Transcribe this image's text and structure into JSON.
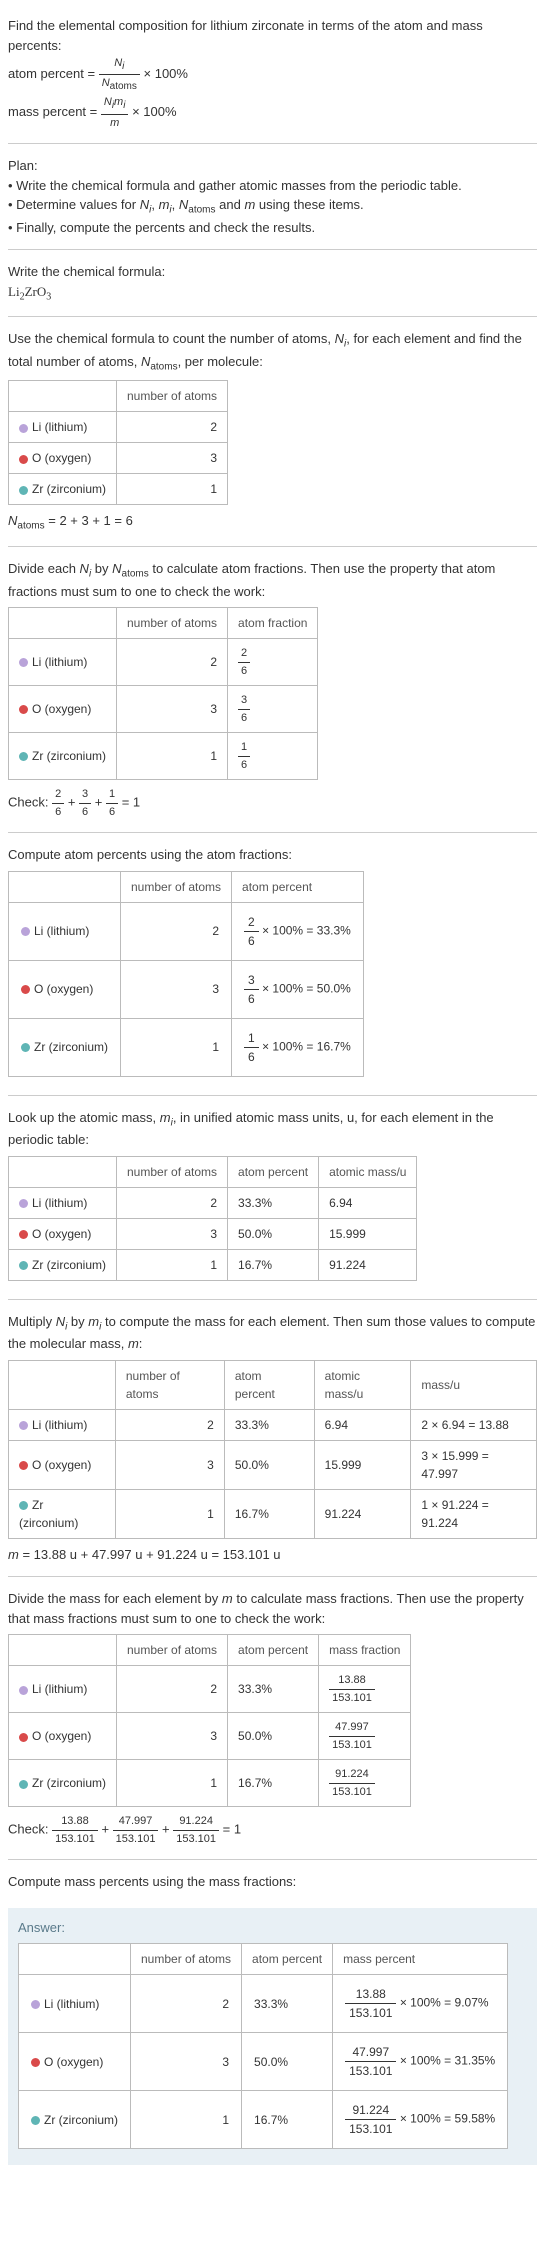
{
  "intro": {
    "line1": "Find the elemental composition for lithium zirconate in terms of the atom and mass percents:",
    "atom_percent_label": "atom percent = ",
    "atom_percent_frac_num": "N_i",
    "atom_percent_frac_den": "N_atoms",
    "times100": " × 100%",
    "mass_percent_label": "mass percent = ",
    "mass_percent_frac_num": "N_i m_i",
    "mass_percent_frac_den": "m"
  },
  "plan": {
    "title": "Plan:",
    "b1": "• Write the chemical formula and gather atomic masses from the periodic table.",
    "b2_a": "• Determine values for ",
    "b2_vars": "N_i, m_i, N_atoms and m",
    "b2_b": " using these items.",
    "b3": "• Finally, compute the percents and check the results."
  },
  "formula_section": {
    "title": "Write the chemical formula:",
    "formula": "Li₂ZrO₃"
  },
  "count_section": {
    "intro_a": "Use the chemical formula to count the number of atoms, ",
    "intro_var1": "N_i",
    "intro_b": ", for each element and find the total number of atoms, ",
    "intro_var2": "N_atoms",
    "intro_c": ", per molecule:",
    "headers": [
      "",
      "number of atoms"
    ],
    "rows": [
      {
        "el": "Li (lithium)",
        "dot": "dot-li",
        "n": "2"
      },
      {
        "el": "O (oxygen)",
        "dot": "dot-o",
        "n": "3"
      },
      {
        "el": "Zr (zirconium)",
        "dot": "dot-zr",
        "n": "1"
      }
    ],
    "sum": "N_atoms = 2 + 3 + 1 = 6"
  },
  "atomfrac_section": {
    "intro": "Divide each N_i by N_atoms to calculate atom fractions. Then use the property that atom fractions must sum to one to check the work:",
    "headers": [
      "",
      "number of atoms",
      "atom fraction"
    ],
    "rows": [
      {
        "el": "Li (lithium)",
        "dot": "dot-li",
        "n": "2",
        "fnum": "2",
        "fden": "6"
      },
      {
        "el": "O (oxygen)",
        "dot": "dot-o",
        "n": "3",
        "fnum": "3",
        "fden": "6"
      },
      {
        "el": "Zr (zirconium)",
        "dot": "dot-zr",
        "n": "1",
        "fnum": "1",
        "fden": "6"
      }
    ],
    "check_label": "Check: ",
    "check_expr": "2/6 + 3/6 + 1/6 = 1"
  },
  "atompercent_section": {
    "intro": "Compute atom percents using the atom fractions:",
    "headers": [
      "",
      "number of atoms",
      "atom percent"
    ],
    "rows": [
      {
        "el": "Li (lithium)",
        "dot": "dot-li",
        "n": "2",
        "fnum": "2",
        "fden": "6",
        "result": " × 100% = 33.3%"
      },
      {
        "el": "O (oxygen)",
        "dot": "dot-o",
        "n": "3",
        "fnum": "3",
        "fden": "6",
        "result": " × 100% = 50.0%"
      },
      {
        "el": "Zr (zirconium)",
        "dot": "dot-zr",
        "n": "1",
        "fnum": "1",
        "fden": "6",
        "result": " × 100% = 16.7%"
      }
    ]
  },
  "atomicmass_section": {
    "intro": "Look up the atomic mass, m_i, in unified atomic mass units, u, for each element in the periodic table:",
    "headers": [
      "",
      "number of atoms",
      "atom percent",
      "atomic mass/u"
    ],
    "rows": [
      {
        "el": "Li (lithium)",
        "dot": "dot-li",
        "n": "2",
        "p": "33.3%",
        "m": "6.94"
      },
      {
        "el": "O (oxygen)",
        "dot": "dot-o",
        "n": "3",
        "p": "50.0%",
        "m": "15.999"
      },
      {
        "el": "Zr (zirconium)",
        "dot": "dot-zr",
        "n": "1",
        "p": "16.7%",
        "m": "91.224"
      }
    ]
  },
  "mass_section": {
    "intro": "Multiply N_i by m_i to compute the mass for each element. Then sum those values to compute the molecular mass, m:",
    "headers": [
      "",
      "number of atoms",
      "atom percent",
      "atomic mass/u",
      "mass/u"
    ],
    "rows": [
      {
        "el": "Li (lithium)",
        "dot": "dot-li",
        "n": "2",
        "p": "33.3%",
        "m": "6.94",
        "calc": "2 × 6.94 = 13.88"
      },
      {
        "el": "O (oxygen)",
        "dot": "dot-o",
        "n": "3",
        "p": "50.0%",
        "m": "15.999",
        "calc": "3 × 15.999 = 47.997"
      },
      {
        "el": "Zr (zirconium)",
        "dot": "dot-zr",
        "n": "1",
        "p": "16.7%",
        "m": "91.224",
        "calc": "1 × 91.224 = 91.224"
      }
    ],
    "total": "m = 13.88 u + 47.997 u + 91.224 u = 153.101 u"
  },
  "massfrac_section": {
    "intro": "Divide the mass for each element by m to calculate mass fractions. Then use the property that mass fractions must sum to one to check the work:",
    "headers": [
      "",
      "number of atoms",
      "atom percent",
      "mass fraction"
    ],
    "rows": [
      {
        "el": "Li (lithium)",
        "dot": "dot-li",
        "n": "2",
        "p": "33.3%",
        "fnum": "13.88",
        "fden": "153.101"
      },
      {
        "el": "O (oxygen)",
        "dot": "dot-o",
        "n": "3",
        "p": "50.0%",
        "fnum": "47.997",
        "fden": "153.101"
      },
      {
        "el": "Zr (zirconium)",
        "dot": "dot-zr",
        "n": "1",
        "p": "16.7%",
        "fnum": "91.224",
        "fden": "153.101"
      }
    ],
    "check_label": "Check: ",
    "check_parts": [
      {
        "num": "13.88",
        "den": "153.101"
      },
      {
        "num": "47.997",
        "den": "153.101"
      },
      {
        "num": "91.224",
        "den": "153.101"
      }
    ],
    "check_eq": " = 1"
  },
  "final_intro": "Compute mass percents using the mass fractions:",
  "answer": {
    "label": "Answer:",
    "headers": [
      "",
      "number of atoms",
      "atom percent",
      "mass percent"
    ],
    "rows": [
      {
        "el": "Li (lithium)",
        "dot": "dot-li",
        "n": "2",
        "p": "33.3%",
        "fnum": "13.88",
        "fden": "153.101",
        "result": " × 100% = 9.07%"
      },
      {
        "el": "O (oxygen)",
        "dot": "dot-o",
        "n": "3",
        "p": "50.0%",
        "fnum": "47.997",
        "fden": "153.101",
        "result": " × 100% = 31.35%"
      },
      {
        "el": "Zr (zirconium)",
        "dot": "dot-zr",
        "n": "1",
        "p": "16.7%",
        "fnum": "91.224",
        "fden": "153.101",
        "result": " × 100% = 59.58%"
      }
    ]
  },
  "chart_data": {
    "type": "table",
    "title": "Elemental composition of lithium zirconate (Li2ZrO3)",
    "elements": [
      {
        "element": "Li",
        "name": "lithium",
        "atoms": 2,
        "atom_fraction": 0.3333,
        "atom_percent": 33.3,
        "atomic_mass_u": 6.94,
        "mass_u": 13.88,
        "mass_fraction": 0.0907,
        "mass_percent": 9.07
      },
      {
        "element": "O",
        "name": "oxygen",
        "atoms": 3,
        "atom_fraction": 0.5,
        "atom_percent": 50.0,
        "atomic_mass_u": 15.999,
        "mass_u": 47.997,
        "mass_fraction": 0.3135,
        "mass_percent": 31.35
      },
      {
        "element": "Zr",
        "name": "zirconium",
        "atoms": 1,
        "atom_fraction": 0.1667,
        "atom_percent": 16.7,
        "atomic_mass_u": 91.224,
        "mass_u": 91.224,
        "mass_fraction": 0.5958,
        "mass_percent": 59.58
      }
    ],
    "N_atoms": 6,
    "molecular_mass_u": 153.101
  }
}
